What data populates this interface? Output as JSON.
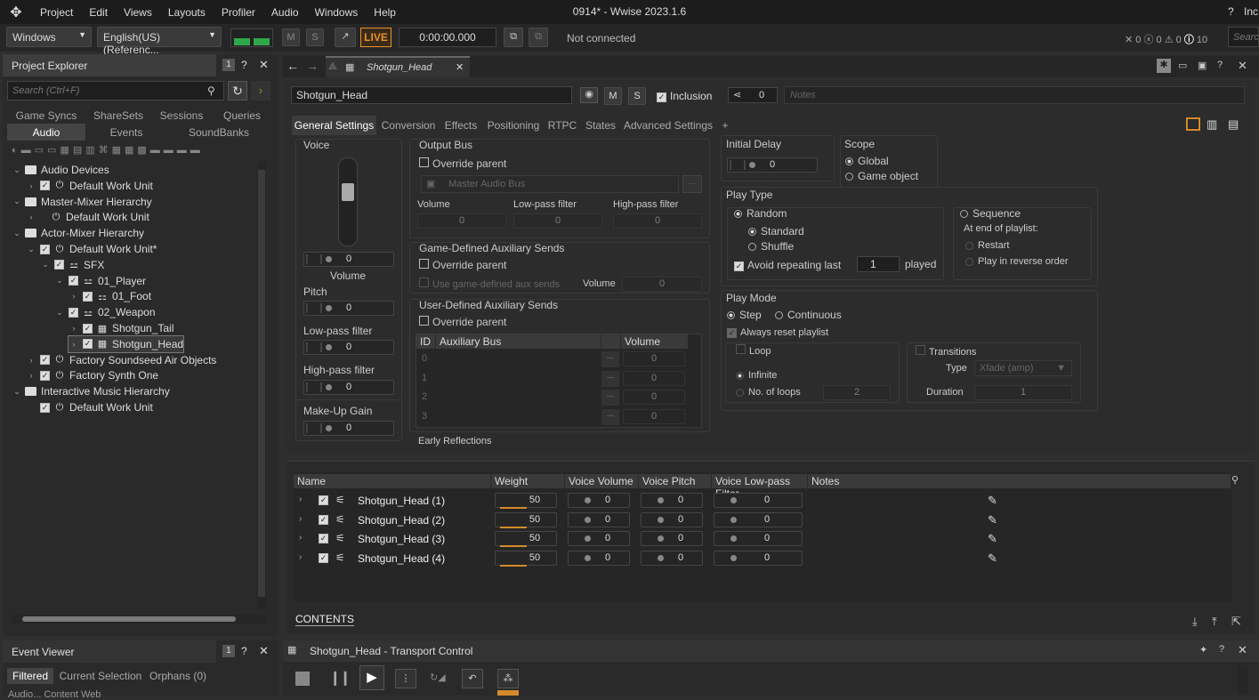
{
  "menubar": {
    "items": [
      "Project",
      "Edit",
      "Views",
      "Layouts",
      "Profiler",
      "Audio",
      "Windows",
      "Help"
    ],
    "title": "0914* - Wwise 2023.1.6",
    "right_text": "Inc"
  },
  "toolbar": {
    "platform": "Windows",
    "language": "English(US) (Referenc...",
    "m_label": "M",
    "s_label": "S",
    "live_label": "LIVE",
    "time": "0:00:00.000",
    "connection": "Not connected",
    "counts": [
      "0",
      "0",
      "0",
      "10"
    ],
    "search_placeholder": "Searc"
  },
  "project_explorer": {
    "title": "Project Explorer",
    "badge": "1",
    "search_placeholder": "Search (Ctrl+F)",
    "tabs_row1": [
      "Game Syncs",
      "ShareSets",
      "Sessions",
      "Queries"
    ],
    "tabs_row2": [
      "Audio",
      "Events",
      "SoundBanks"
    ],
    "tree": [
      {
        "label": "Audio Devices",
        "indent": 0,
        "chev": "⌄",
        "kind": "folder"
      },
      {
        "label": "Default Work Unit",
        "indent": 1,
        "chev": "›",
        "kind": "wu",
        "check": true
      },
      {
        "label": "Master-Mixer Hierarchy",
        "indent": 0,
        "chev": "⌄",
        "kind": "folder"
      },
      {
        "label": "Default Work Unit",
        "indent": 1,
        "chev": "›",
        "kind": "wu",
        "check": false
      },
      {
        "label": "Actor-Mixer Hierarchy",
        "indent": 0,
        "chev": "⌄",
        "kind": "folder"
      },
      {
        "label": "Default Work Unit*",
        "indent": 1,
        "chev": "⌄",
        "kind": "wu",
        "check": true
      },
      {
        "label": "SFX",
        "indent": 2,
        "chev": "⌄",
        "kind": "mixer",
        "check": true
      },
      {
        "label": "01_Player",
        "indent": 3,
        "chev": "⌄",
        "kind": "mixer",
        "check": true
      },
      {
        "label": "01_Foot",
        "indent": 4,
        "chev": "›",
        "kind": "switch",
        "check": true
      },
      {
        "label": "02_Weapon",
        "indent": 3,
        "chev": "⌄",
        "kind": "mixer",
        "check": true
      },
      {
        "label": "Shotgun_Tail",
        "indent": 4,
        "chev": "›",
        "kind": "random",
        "check": true
      },
      {
        "label": "Shotgun_Head",
        "indent": 4,
        "chev": "›",
        "kind": "random",
        "check": true,
        "selected": true
      },
      {
        "label": "Factory Soundseed Air Objects",
        "indent": 1,
        "chev": "›",
        "kind": "wu",
        "check": true
      },
      {
        "label": "Factory Synth One",
        "indent": 1,
        "chev": "›",
        "kind": "wu",
        "check": true
      },
      {
        "label": "Interactive Music Hierarchy",
        "indent": 0,
        "chev": "⌄",
        "kind": "folder"
      },
      {
        "label": "Default Work Unit",
        "indent": 1,
        "chev": "",
        "kind": "wu",
        "check": true
      }
    ]
  },
  "event_viewer": {
    "title": "Event Viewer",
    "badge": "1",
    "tabs": [
      "Filtered",
      "Current Selection",
      "Orphans (0)"
    ],
    "bottom_text": "Audio... Content Web"
  },
  "editor": {
    "tab_title": "Shotgun_Head",
    "name": "Shotgun_Head",
    "m": "M",
    "s": "S",
    "inclusion": "Inclusion",
    "ref_count": "0",
    "notes_placeholder": "Notes",
    "tabs": [
      "General Settings",
      "Conversion",
      "Effects",
      "Positioning",
      "RTPC",
      "States",
      "Advanced Settings",
      "+"
    ],
    "voice": {
      "title": "Voice",
      "volume_value": "0",
      "volume_label": "Volume",
      "pitch_label": "Pitch",
      "pitch_value": "0",
      "lpf_label": "Low-pass filter",
      "lpf_value": "0",
      "hpf_label": "High-pass filter",
      "hpf_value": "0",
      "makeup_label": "Make-Up Gain",
      "makeup_value": "0"
    },
    "output_bus": {
      "title": "Output Bus",
      "override": "Override parent",
      "bus": "Master Audio Bus",
      "browse": "...",
      "volume": "Volume",
      "lpf": "Low-pass filter",
      "hpf": "High-pass filter",
      "v1": "0",
      "v2": "0",
      "v3": "0"
    },
    "game_aux": {
      "title": "Game-Defined Auxiliary Sends",
      "override": "Override parent",
      "use": "Use game-defined aux sends",
      "volume": "Volume",
      "value": "0"
    },
    "user_aux": {
      "title": "User-Defined Auxiliary Sends",
      "override": "Override parent",
      "col_id": "ID",
      "col_bus": "Auxiliary Bus",
      "col_vol": "Volume",
      "rows": [
        "0",
        "1",
        "2",
        "3"
      ],
      "row_val": "0",
      "browse": "..."
    },
    "early_reflections": "Early Reflections",
    "initial_delay": {
      "title": "Initial Delay",
      "value": "0"
    },
    "scope": {
      "title": "Scope",
      "global": "Global",
      "game_object": "Game object"
    },
    "play_type": {
      "title": "Play Type",
      "random": "Random",
      "standard": "Standard",
      "shuffle": "Shuffle",
      "avoid": "Avoid repeating last",
      "avoid_value": "1",
      "played": "played",
      "sequence": "Sequence",
      "at_end": "At end of playlist:",
      "restart": "Restart",
      "reverse": "Play in reverse order"
    },
    "play_mode": {
      "title": "Play Mode",
      "step": "Step",
      "continuous": "Continuous",
      "always_reset": "Always reset playlist",
      "loop": "Loop",
      "infinite": "Infinite",
      "no_loops": "No. of loops",
      "loops_value": "2",
      "transitions": "Transitions",
      "type_label": "Type",
      "type_value": "Xfade (amp)",
      "duration_label": "Duration",
      "duration_value": "1"
    }
  },
  "contents": {
    "label": "CONTENTS",
    "columns": [
      "Name",
      "Weight",
      "Voice Volume",
      "Voice Pitch",
      "Voice Low-pass Filter",
      "Notes"
    ],
    "rows": [
      {
        "name": "Shotgun_Head (1)",
        "weight": "50",
        "vol": "0",
        "pitch": "0",
        "lpf": "0"
      },
      {
        "name": "Shotgun_Head (2)",
        "weight": "50",
        "vol": "0",
        "pitch": "0",
        "lpf": "0"
      },
      {
        "name": "Shotgun_Head (3)",
        "weight": "50",
        "vol": "0",
        "pitch": "0",
        "lpf": "0"
      },
      {
        "name": "Shotgun_Head (4)",
        "weight": "50",
        "vol": "0",
        "pitch": "0",
        "lpf": "0"
      }
    ]
  },
  "transport": {
    "title": "Shotgun_Head - Transport Control"
  },
  "colors": {
    "accent": "#d48a2a",
    "live": "#e8922a",
    "meter": "#2fa84a"
  }
}
